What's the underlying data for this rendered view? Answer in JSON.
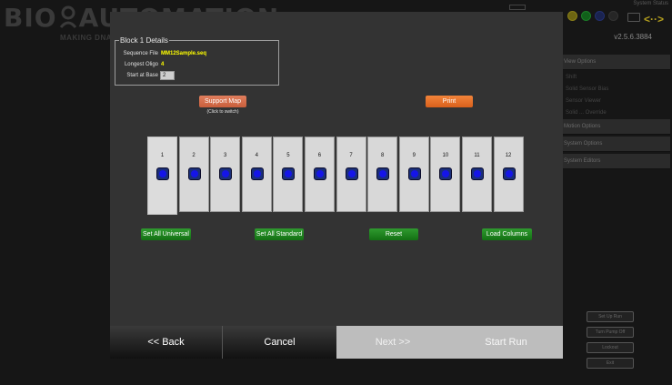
{
  "background": {
    "logo_left": "BIO",
    "logo_right": "AUTOMATION",
    "tagline": "MAKING DNA/RNA",
    "system_status": "System Status",
    "version": "v2.5.6.3884",
    "status_lights": [
      "#b3a81c",
      "#1f9b2b",
      "#1f3a8a",
      "#3a3a3a"
    ],
    "panel": {
      "view_options": "View Options",
      "view_sub": [
        "Shift",
        "Solid Sensor Bias",
        "Sensor Viewer",
        "Solid ... Override"
      ],
      "motion_options": "Motion Options",
      "system_options": "System Options",
      "system_editors": "System Editors"
    },
    "side_buttons": [
      "Set Up Run",
      "Turn Pump Off",
      "Lockout",
      "Exit"
    ]
  },
  "dialog": {
    "details_title": "Block 1 Details",
    "sequence_file_label": "Sequence File",
    "sequence_file_value": "MM12Sample.seq",
    "longest_oligo_label": "Longest Oligo",
    "longest_oligo_value": "4",
    "start_at_base_label": "Start at Base",
    "start_at_base_value": "2",
    "support_map_label": "Support Map",
    "switch_hint": "(Click to switch)",
    "print_label": "Print",
    "columns": [
      "1",
      "2",
      "3",
      "4",
      "5",
      "6",
      "7",
      "8",
      "9",
      "10",
      "11",
      "12"
    ],
    "set_all_universal": "Set All Universal",
    "set_all_standard": "Set All Standard",
    "reset": "Reset",
    "load_columns": "Load Columns",
    "back": "<< Back",
    "cancel": "Cancel",
    "next": "Next >>",
    "start_run": "Start Run"
  }
}
